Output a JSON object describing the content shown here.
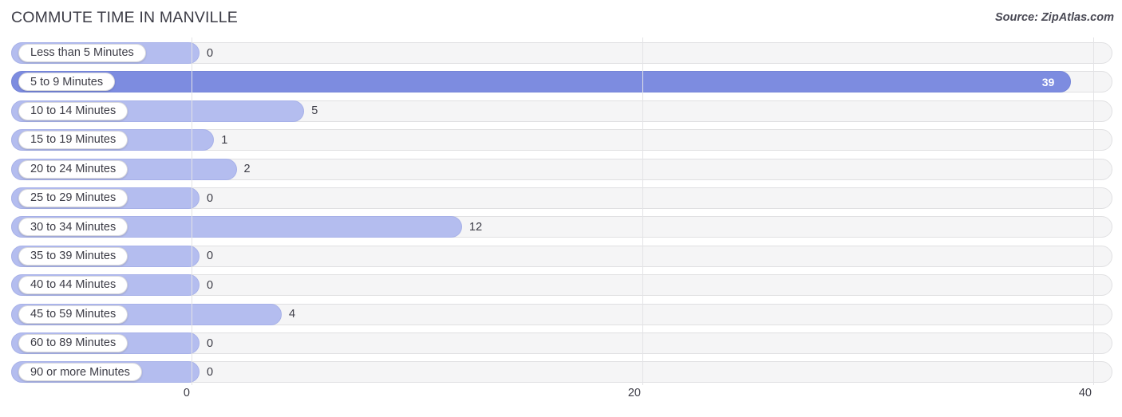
{
  "header": {
    "title": "COMMUTE TIME IN MANVILLE",
    "source": "Source: ZipAtlas.com"
  },
  "chart_data": {
    "type": "bar",
    "orientation": "horizontal",
    "title": "COMMUTE TIME IN MANVILLE",
    "xlabel": "",
    "ylabel": "",
    "xlim": [
      0,
      40
    ],
    "xticks": [
      0,
      20,
      40
    ],
    "xtick_labels": [
      "0",
      "20",
      "40"
    ],
    "grid": true,
    "legend": false,
    "highlight_color": "#7d8ce0",
    "bar_color": "#b4bdef",
    "track_color": "#f5f5f6",
    "categories": [
      "Less than 5 Minutes",
      "5 to 9 Minutes",
      "10 to 14 Minutes",
      "15 to 19 Minutes",
      "20 to 24 Minutes",
      "25 to 29 Minutes",
      "30 to 34 Minutes",
      "35 to 39 Minutes",
      "40 to 44 Minutes",
      "45 to 59 Minutes",
      "60 to 89 Minutes",
      "90 or more Minutes"
    ],
    "values": [
      0,
      39,
      5,
      1,
      2,
      0,
      12,
      0,
      0,
      4,
      0,
      0
    ],
    "value_labels": [
      "0",
      "39",
      "5",
      "1",
      "2",
      "0",
      "12",
      "0",
      "0",
      "4",
      "0",
      "0"
    ],
    "max_value": 39,
    "max_category": "5 to 9 Minutes"
  }
}
